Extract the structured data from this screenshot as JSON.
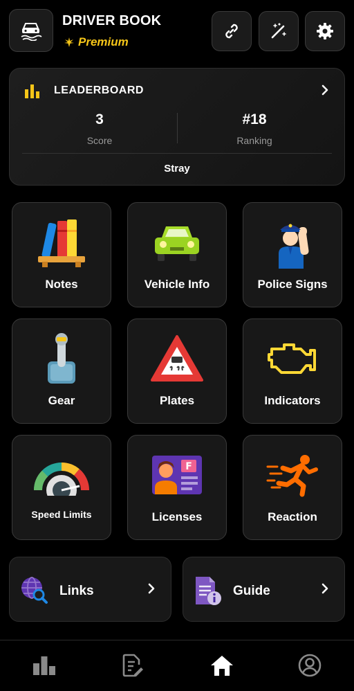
{
  "header": {
    "title": "DRIVER BOOK",
    "subtitle": "Premium",
    "buttons": [
      "link-icon",
      "magic-wand-icon",
      "gear-icon"
    ]
  },
  "leaderboard": {
    "title": "LEADERBOARD",
    "score_value": "3",
    "score_label": "Score",
    "ranking_value": "#18",
    "ranking_label": "Ranking",
    "user": "Stray"
  },
  "tiles": [
    {
      "label": "Notes",
      "icon": "books-icon"
    },
    {
      "label": "Vehicle Info",
      "icon": "car-icon"
    },
    {
      "label": "Police Signs",
      "icon": "police-officer-icon"
    },
    {
      "label": "Gear",
      "icon": "gear-stick-icon"
    },
    {
      "label": "Plates",
      "icon": "slippery-road-sign-icon"
    },
    {
      "label": "Indicators",
      "icon": "check-engine-icon"
    },
    {
      "label": "Speed Limits",
      "icon": "speedometer-icon"
    },
    {
      "label": "Licenses",
      "icon": "driver-license-icon"
    },
    {
      "label": "Reaction",
      "icon": "running-man-icon"
    }
  ],
  "wide_cards": [
    {
      "label": "Links",
      "icon": "globe-search-icon"
    },
    {
      "label": "Guide",
      "icon": "document-info-icon"
    }
  ],
  "bottom_nav": [
    "stats-icon",
    "edit-document-icon",
    "home-icon",
    "profile-icon"
  ],
  "colors": {
    "accent": "#f5c518",
    "background": "#000000",
    "card": "#181818"
  }
}
